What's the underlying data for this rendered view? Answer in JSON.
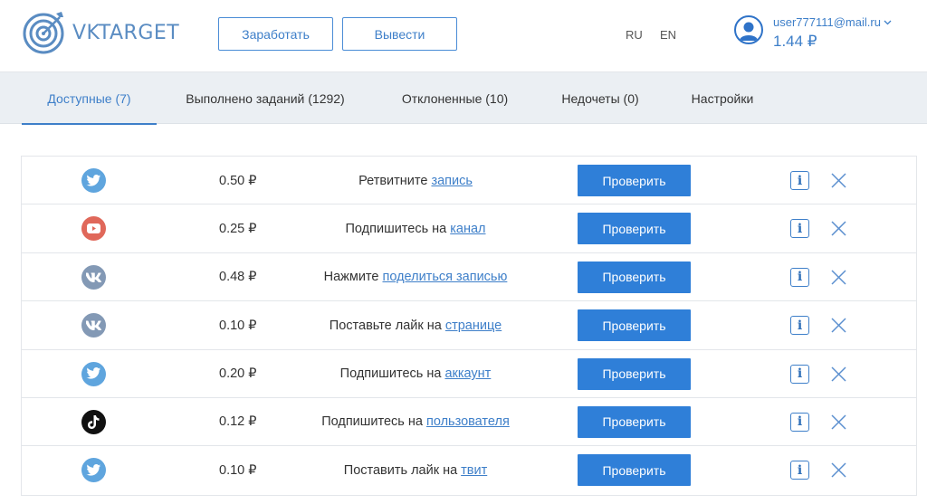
{
  "header": {
    "logo_text": "VKTARGET",
    "earn_label": "Заработать",
    "withdraw_label": "Вывести",
    "lang_ru": "RU",
    "lang_en": "EN",
    "user_email": "user777111@mail.ru",
    "balance": "1.44 ₽"
  },
  "tabs": [
    {
      "label": "Доступные (7)",
      "active": true
    },
    {
      "label": "Выполнено заданий (1292)",
      "active": false
    },
    {
      "label": "Отклоненные (10)",
      "active": false
    },
    {
      "label": "Недочеты (0)",
      "active": false
    },
    {
      "label": "Настройки",
      "active": false
    }
  ],
  "tasks": [
    {
      "network": "twitter-icon",
      "price": "0.50 ₽",
      "text": "Ретвитните",
      "link": "запись",
      "button": "Проверить"
    },
    {
      "network": "youtube-icon",
      "price": "0.25 ₽",
      "text": "Подпишитесь на",
      "link": "канал",
      "button": "Проверить"
    },
    {
      "network": "vk-icon",
      "price": "0.48 ₽",
      "text": "Нажмите",
      "link": "поделиться записью",
      "button": "Проверить"
    },
    {
      "network": "vk-icon",
      "price": "0.10 ₽",
      "text": "Поставьте лайк на",
      "link": "странице",
      "button": "Проверить"
    },
    {
      "network": "twitter-icon",
      "price": "0.20 ₽",
      "text": "Подпишитесь на",
      "link": "аккаунт",
      "button": "Проверить"
    },
    {
      "network": "tiktok-icon",
      "price": "0.12 ₽",
      "text": "Подпишитесь на",
      "link": "пользователя",
      "button": "Проверить"
    },
    {
      "network": "twitter-icon",
      "price": "0.10 ₽",
      "text": "Поставить лайк на",
      "link": "твит",
      "button": "Проверить"
    }
  ],
  "colors": {
    "accent": "#3e7fc9",
    "button_bg": "#2f7fd8",
    "tab_bar_bg": "#ebeff3",
    "twitter": "#5fa5de",
    "youtube": "#e0685a",
    "vk": "#8399b5",
    "tiktok": "#111111"
  }
}
